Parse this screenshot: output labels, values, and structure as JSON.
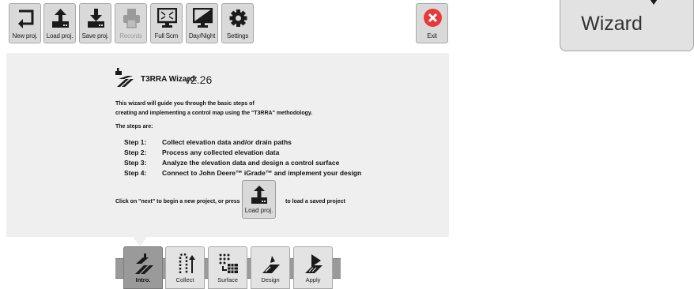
{
  "toolbar": {
    "new_proj": "New proj.",
    "load_proj": "Load proj.",
    "save_proj": "Save proj.",
    "records": "Records",
    "full_scrn": "Full Scrn",
    "day_night": "Day/Night",
    "settings": "Settings",
    "exit": "Exit"
  },
  "wizard_panel": {
    "title": "T3RRA Wizard:",
    "version": "v2.26",
    "intro_line1": "This wizard will guide you through the basic steps of",
    "intro_line2": "creating and implementing a control map using the \"T3RRA\" methodology.",
    "steps_heading": "The steps are:",
    "steps": [
      {
        "number": "Step 1:",
        "text": "Collect elevation data and/or drain paths"
      },
      {
        "number": "Step 2:",
        "text": "Process any collected elevation data"
      },
      {
        "number": "Step 3:",
        "text": "Analyze the elevation data and design a control surface"
      },
      {
        "number": "Step 4:",
        "text": "Connect to John Deere™ iGrade™ and implement your design"
      }
    ],
    "prompt_before": "Click on \"next\" to begin a new project, or press",
    "load_button": "Load proj.",
    "prompt_after": "to load a saved project"
  },
  "nav_tabs": [
    {
      "label": "Intro.",
      "active": true
    },
    {
      "label": "Collect",
      "active": false
    },
    {
      "label": "Surface",
      "active": false
    },
    {
      "label": "Design",
      "active": false
    },
    {
      "label": "Apply",
      "active": false
    }
  ],
  "wizard_button": {
    "label": "Wizard"
  },
  "icons": {
    "new_proj": "return-arrow-icon",
    "load_proj": "upload-icon",
    "save_proj": "download-icon",
    "records": "printer-icon",
    "full_scrn": "fullscreen-monitor-icon",
    "day_night": "day-night-monitor-icon",
    "settings": "gear-icon",
    "exit": "close-circle-icon"
  },
  "colors": {
    "exit_red": "#e8383b",
    "panel_bg": "#efefef",
    "button_bg": "#d9d9d9",
    "active_tab": "#9a9a9a"
  }
}
